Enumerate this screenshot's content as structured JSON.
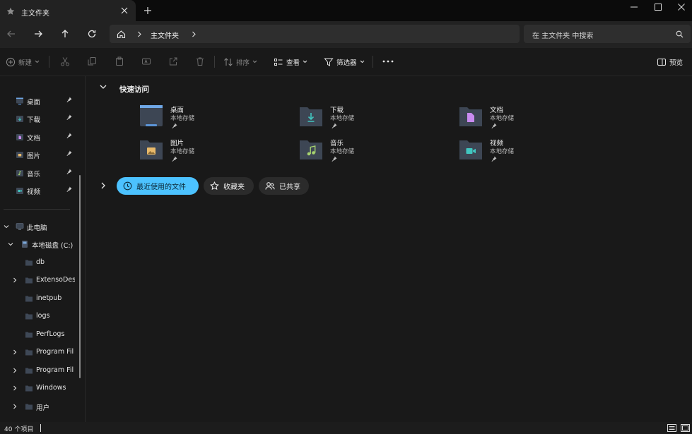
{
  "tab": {
    "title": "主文件夹"
  },
  "address": {
    "crumb": "主文件夹"
  },
  "search": {
    "placeholder": "在 主文件夹 中搜索"
  },
  "toolbar": {
    "new_label": "新建",
    "sort_label": "排序",
    "view_label": "查看",
    "filter_label": "筛选器",
    "preview_label": "预览"
  },
  "sidebar": {
    "pinned": [
      {
        "label": "桌面",
        "icon": "desktop-icon"
      },
      {
        "label": "下载",
        "icon": "download-folder-icon"
      },
      {
        "label": "文档",
        "icon": "documents-folder-icon"
      },
      {
        "label": "图片",
        "icon": "pictures-folder-icon"
      },
      {
        "label": "音乐",
        "icon": "music-folder-icon"
      },
      {
        "label": "视频",
        "icon": "videos-folder-icon"
      }
    ],
    "tree": [
      {
        "label": "此电脑"
      },
      {
        "label": "本地磁盘 (C:)"
      },
      {
        "label": "db"
      },
      {
        "label": "ExtensoDes"
      },
      {
        "label": "inetpub"
      },
      {
        "label": "logs"
      },
      {
        "label": "PerfLogs"
      },
      {
        "label": "Program Fil"
      },
      {
        "label": "Program Fil"
      },
      {
        "label": "Windows"
      },
      {
        "label": "用户"
      }
    ]
  },
  "main": {
    "section_title": "快速访问",
    "quick_access": [
      {
        "name": "桌面",
        "sub": "本地存储"
      },
      {
        "name": "下载",
        "sub": "本地存储"
      },
      {
        "name": "文档",
        "sub": "本地存储"
      },
      {
        "name": "图片",
        "sub": "本地存储"
      },
      {
        "name": "音乐",
        "sub": "本地存储"
      },
      {
        "name": "视频",
        "sub": "本地存储"
      }
    ],
    "chips": {
      "recent": "最近使用的文件",
      "favorites": "收藏夹",
      "shared": "已共享"
    }
  },
  "status": {
    "count": "40 个项目"
  },
  "colors": {
    "accent": "#4cc2ff",
    "background": "#191919",
    "folder": "#3d4654"
  }
}
